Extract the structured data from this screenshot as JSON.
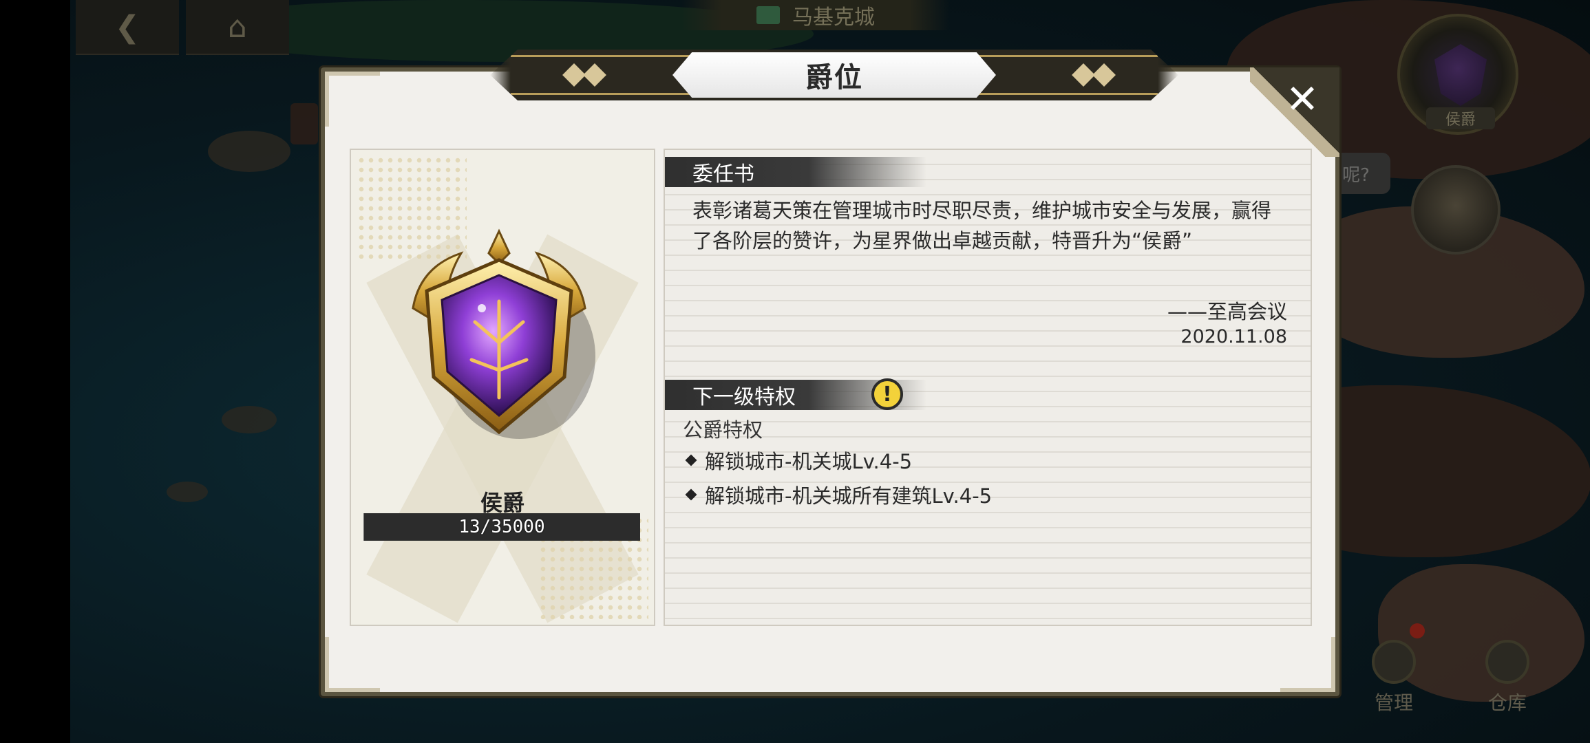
{
  "background": {
    "city_name": "马基克城",
    "current_rank_badge": "侯爵",
    "speech_bubble": "呢?",
    "buttons": {
      "manage": "管理",
      "warehouse": "仓库"
    }
  },
  "modal": {
    "title": "爵位",
    "close_icon": "close-icon",
    "rank_card": {
      "rank_name": "侯爵",
      "progress_text": "13/35000",
      "progress_fraction": 0.00037
    },
    "commission": {
      "header": "委任书",
      "body": "表彰诸葛天策在管理城市时尽职尽责，维护城市安全与发展，赢得了各阶层的赞许，为星界做出卓越贡献，特晋升为“侯爵”",
      "signature": "——至高会议",
      "date": "2020.11.08"
    },
    "next_privilege": {
      "header": "下一级特权",
      "tier_name": "公爵特权",
      "items": [
        "解锁城市-机关城Lv.4-5",
        "解锁城市-机关城所有建筑Lv.4-5"
      ]
    }
  }
}
